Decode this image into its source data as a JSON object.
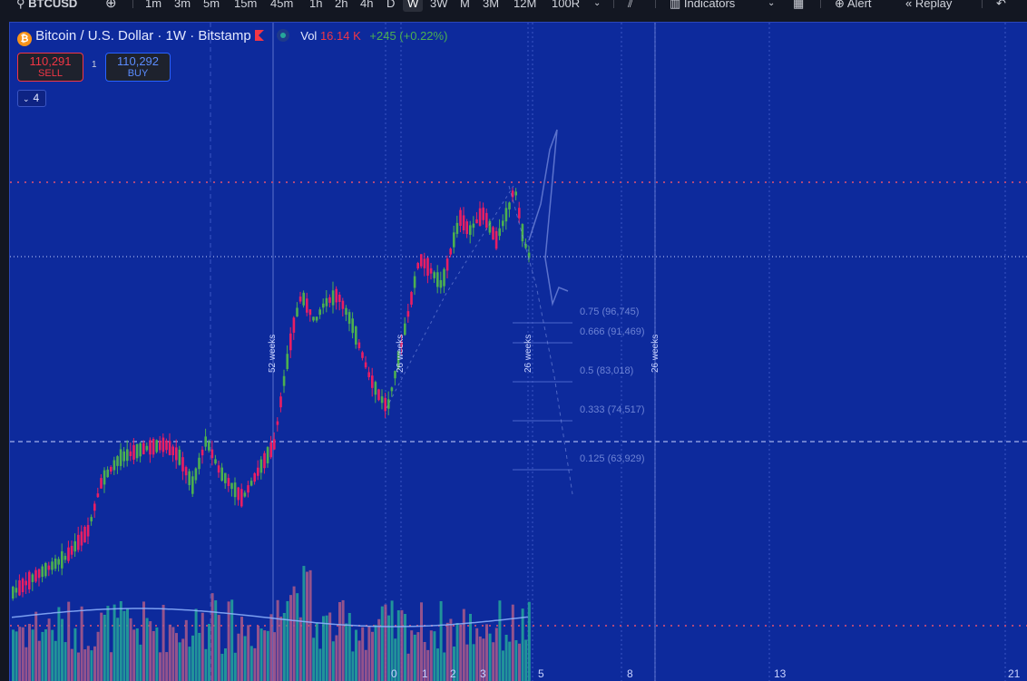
{
  "toolbar": {
    "symbol": "BTCUSD",
    "intervals": [
      "1m",
      "3m",
      "5m",
      "15m",
      "45m",
      "1h",
      "2h",
      "4h",
      "D",
      "W",
      "3W",
      "M",
      "3M",
      "12M",
      "100R"
    ],
    "active_interval": "W",
    "indicators_label": "Indicators",
    "alert_label": "Alert",
    "replay_label": "Replay"
  },
  "legend": {
    "title": "Bitcoin / U.S. Dollar · 1W · Bitstamp",
    "vol_label": "Vol",
    "vol_value": "16.14 K",
    "change": "+245 (+0.22%)"
  },
  "trade": {
    "sell_price": "110,291",
    "sell_label": "SELL",
    "buy_price": "110,292",
    "buy_label": "BUY",
    "quantity": "1"
  },
  "indicators_count": "4",
  "fib_levels": [
    {
      "label": "0.75 (96,745)"
    },
    {
      "label": "0.666 (91,469)"
    },
    {
      "label": "0.5 (83,018)"
    },
    {
      "label": "0.333 (74,517)"
    },
    {
      "label": "0.125 (63,929)"
    }
  ],
  "cycle_labels": [
    "52 weeks",
    "26 weeks",
    "26 weeks",
    "26 weeks"
  ],
  "x_ticks": [
    "0",
    "1",
    "2",
    "3",
    "5",
    "8",
    "13",
    "21"
  ],
  "colors": {
    "background": "#0d2a9c",
    "up": "#4caf50",
    "down": "#e91e63",
    "volume_up": "#26a69a",
    "volume_down": "#ad5a8a",
    "ma": "#8fb4ff"
  }
}
